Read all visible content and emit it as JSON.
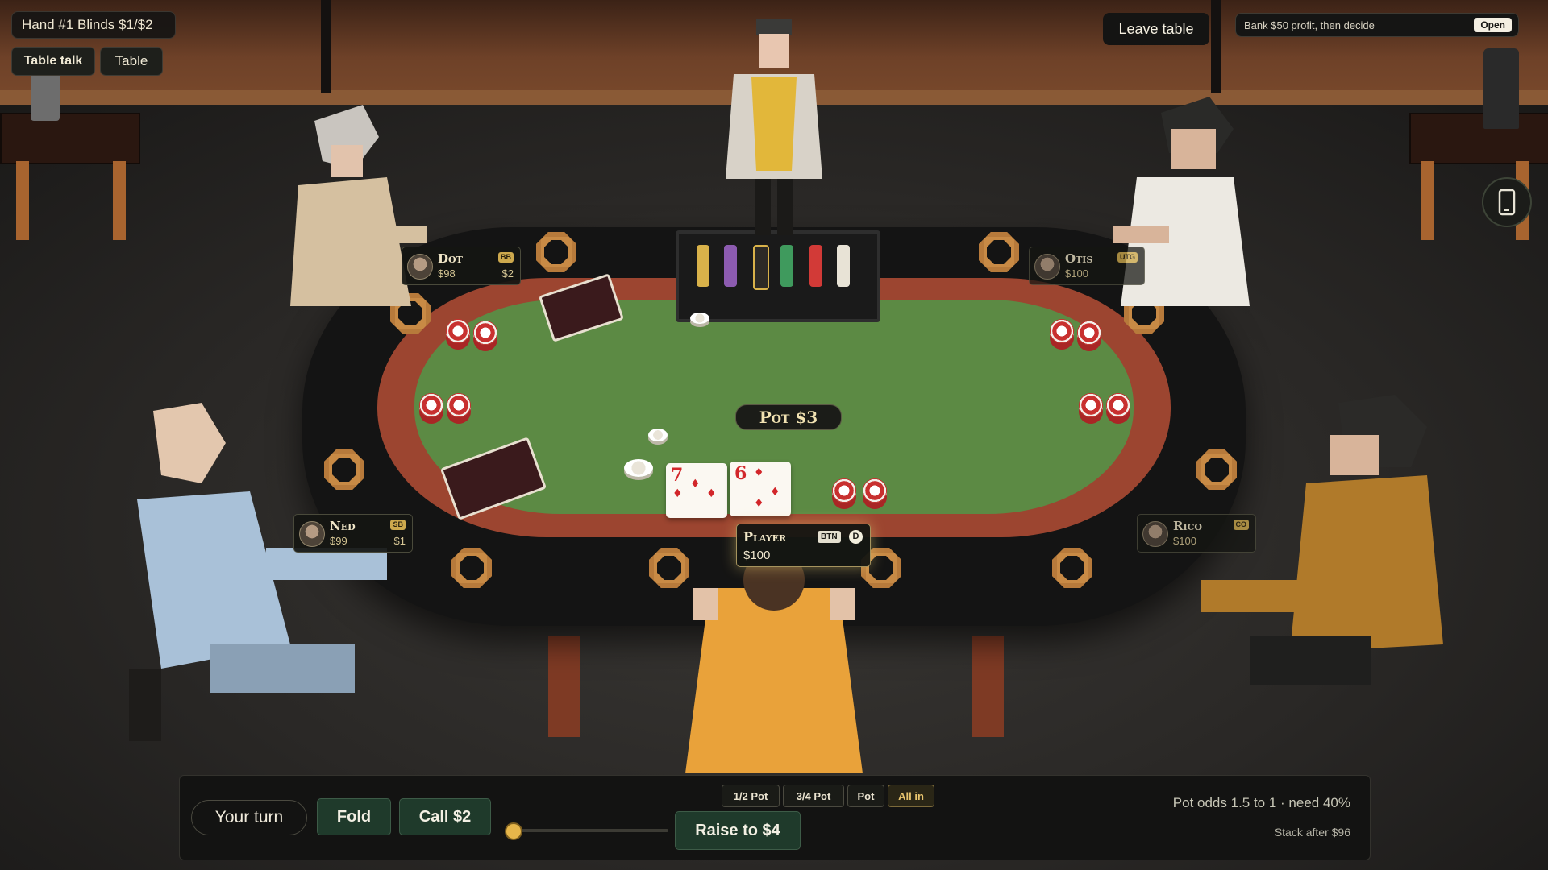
{
  "hud": {
    "hand_info": "Hand #1 Blinds $1/$2",
    "table_talk_label": "Table talk",
    "table_label": "Table",
    "leave_label": "Leave table",
    "bank_text": "Bank $50 profit, then decide",
    "open_label": "Open",
    "phone_icon": "phone-icon"
  },
  "table": {
    "pot_label": "Pot $3"
  },
  "seats": {
    "dot": {
      "name": "Dot",
      "stack": "$98",
      "bet": "$2",
      "position": "BB"
    },
    "otis": {
      "name": "Otis",
      "stack": "$100",
      "position": "UTG"
    },
    "ned": {
      "name": "Ned",
      "stack": "$99",
      "bet": "$1",
      "position": "SB"
    },
    "rico": {
      "name": "Rico",
      "stack": "$100",
      "position": "CO"
    },
    "player": {
      "name": "Player",
      "stack": "$100",
      "position": "BTN",
      "dealer": "D"
    }
  },
  "hole_cards": [
    {
      "rank": "7",
      "suit": "♦"
    },
    {
      "rank": "6",
      "suit": "♦"
    }
  ],
  "actions": {
    "turn_label": "Your turn",
    "fold_label": "Fold",
    "call_label": "Call $2",
    "raise_label": "Raise to $4",
    "presets": [
      "1/2 Pot",
      "3/4 Pot",
      "Pot",
      "All in"
    ],
    "pot_odds": "Pot odds 1.5 to 1 · need 40%",
    "stack_after": "Stack after $96",
    "raise_slider_fraction": 0.0
  },
  "colors": {
    "felt": "#5c8a44",
    "rail": "#141414",
    "accent_gold": "#e6b64a",
    "action_green": "#1f3a2b"
  }
}
